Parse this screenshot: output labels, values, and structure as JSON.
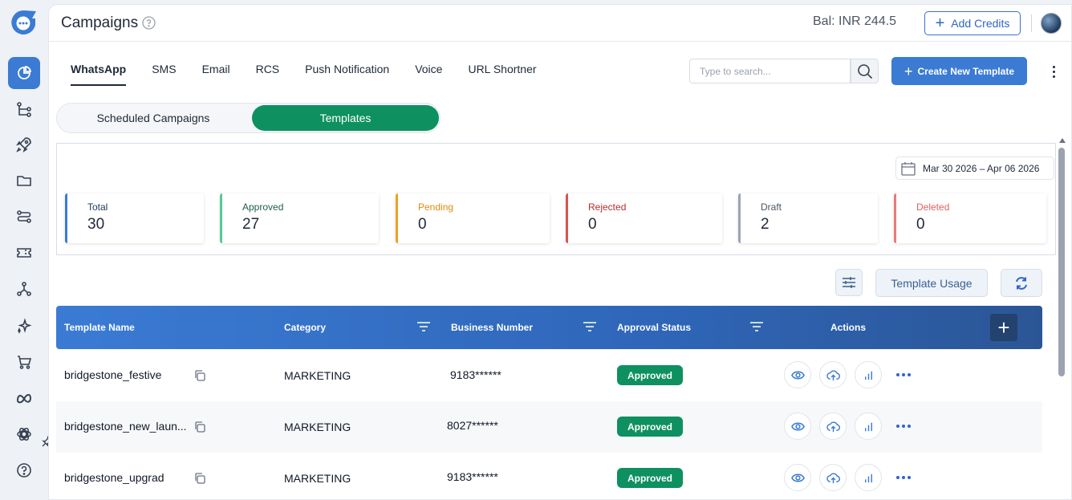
{
  "header": {
    "title": "Campaigns",
    "balance": "Bal: INR 244.5",
    "add_credits_label": "Add Credits"
  },
  "tabs": [
    {
      "label": "WhatsApp",
      "active": true
    },
    {
      "label": "SMS"
    },
    {
      "label": "Email"
    },
    {
      "label": "RCS"
    },
    {
      "label": "Push Notification"
    },
    {
      "label": "Voice"
    },
    {
      "label": "URL Shortner"
    }
  ],
  "search": {
    "placeholder": "Type to search..."
  },
  "create_template_label": "Create New Template",
  "segmented": {
    "scheduled_label": "Scheduled Campaigns",
    "templates_label": "Templates"
  },
  "date_range": "Mar 30 2026 – Apr 06 2026",
  "stats": [
    {
      "label": "Total",
      "value": "30",
      "color": "#3b7bd4",
      "label_color": "#1f3a5f"
    },
    {
      "label": "Approved",
      "value": "27",
      "color": "#54c99a",
      "label_color": "#1f5f43"
    },
    {
      "label": "Pending",
      "value": "0",
      "color": "#f0a020",
      "label_color": "#e08a10"
    },
    {
      "label": "Rejected",
      "value": "0",
      "color": "#d9534f",
      "label_color": "#b3302c"
    },
    {
      "label": "Draft",
      "value": "2",
      "color": "#9aa5b8",
      "label_color": "#4b5563"
    },
    {
      "label": "Deleted",
      "value": "0",
      "color": "#e87b7b",
      "label_color": "#e06060"
    }
  ],
  "toolbar": {
    "template_usage_label": "Template Usage"
  },
  "table": {
    "columns": {
      "name": "Template Name",
      "category": "Category",
      "business_number": "Business Number",
      "approval_status": "Approval Status",
      "actions": "Actions"
    },
    "rows": [
      {
        "name": "bridgestone_festive",
        "category": "MARKETING",
        "number": "9183******",
        "status": "Approved"
      },
      {
        "name": "bridgestone_new_laun...",
        "category": "MARKETING",
        "number": "8027******",
        "status": "Approved"
      },
      {
        "name": "bridgestone_upgrad",
        "category": "MARKETING",
        "number": "9183******",
        "status": "Approved"
      }
    ]
  },
  "colors": {
    "accent": "#3b7bd4",
    "success": "#0e9060"
  },
  "icons": {
    "sidebar": [
      "dashboard-icon",
      "flow-icon",
      "rocket-icon",
      "folder-icon",
      "route-icon",
      "ticket-icon",
      "network-icon",
      "sparkle-icon",
      "cart-icon",
      "meta-icon",
      "openai-icon",
      "help-icon"
    ]
  }
}
